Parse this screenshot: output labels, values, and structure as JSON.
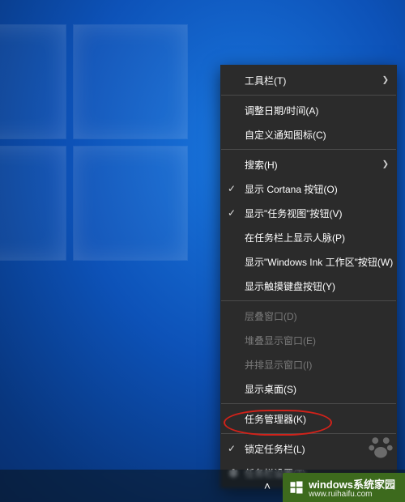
{
  "context_menu": {
    "toolbars": "工具栏(T)",
    "adjust_datetime": "调整日期/时间(A)",
    "customize_tray": "自定义通知图标(C)",
    "search": "搜索(H)",
    "show_cortana_btn": "显示 Cortana 按钮(O)",
    "show_taskview_btn": "显示\"任务视图\"按钮(V)",
    "show_people": "在任务栏上显示人脉(P)",
    "show_ink": "显示\"Windows Ink 工作区\"按钮(W)",
    "show_touch_kb": "显示触摸键盘按钮(Y)",
    "cascade": "层叠窗口(D)",
    "stack": "堆叠显示窗口(E)",
    "side_by_side": "并排显示窗口(I)",
    "show_desktop": "显示桌面(S)",
    "task_manager": "任务管理器(K)",
    "lock_taskbar": "锁定任务栏(L)",
    "taskbar_settings": "任务栏设置(T)"
  },
  "watermark": {
    "brand": "windows系统家园",
    "sub": "www.ruihaifu.com"
  }
}
